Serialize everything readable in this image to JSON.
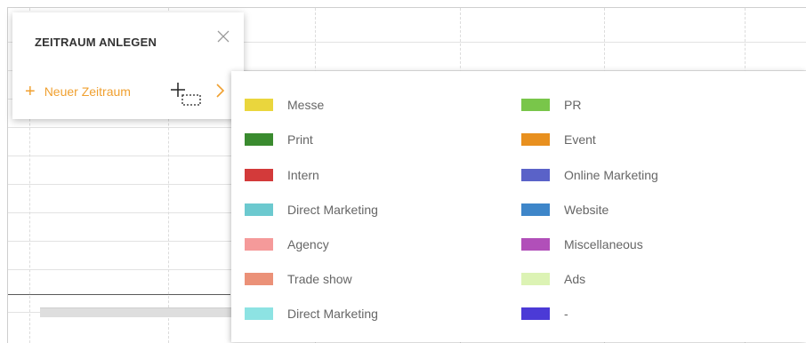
{
  "popup": {
    "title": "ZEITRAUM ANLEGEN",
    "new_period_label": "Neuer Zeitraum"
  },
  "categories_left": [
    {
      "label": "Messe",
      "color": "#ead63d"
    },
    {
      "label": "Print",
      "color": "#3a8b2f"
    },
    {
      "label": "Intern",
      "color": "#d33a3a"
    },
    {
      "label": "Direct Marketing",
      "color": "#6cc9cf"
    },
    {
      "label": "Agency",
      "color": "#f59a9a"
    },
    {
      "label": "Trade show",
      "color": "#eb9178"
    },
    {
      "label": "Direct Marketing",
      "color": "#8de3e3"
    }
  ],
  "categories_right": [
    {
      "label": "PR",
      "color": "#79c64a"
    },
    {
      "label": "Event",
      "color": "#e8901f"
    },
    {
      "label": "Online Marketing",
      "color": "#5a62c8"
    },
    {
      "label": "Website",
      "color": "#3e86c9"
    },
    {
      "label": "Miscellaneous",
      "color": "#b14fb9"
    },
    {
      "label": "Ads",
      "color": "#dcf3b4"
    },
    {
      "label": "-",
      "color": "#4b3ad6"
    }
  ],
  "accent_color": "#f0a030"
}
